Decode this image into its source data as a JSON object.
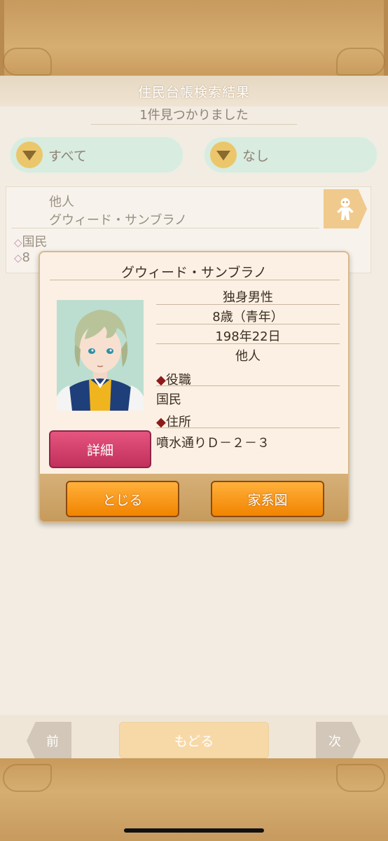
{
  "header": {
    "title": "住民台帳検索結果",
    "subtitle": "1件見つかりました"
  },
  "filters": [
    {
      "label": "すべて"
    },
    {
      "label": "なし"
    }
  ],
  "result_row": {
    "relation": "他人",
    "name": "グウィード・サンブラノ",
    "role_marker": "◇",
    "role": "国民",
    "address_marker": "◇",
    "address_partial": "8"
  },
  "modal": {
    "name": "グウィード・サンブラノ",
    "status": "独身男性",
    "age": "8歳（青年）",
    "birthday": "198年22日",
    "relation": "他人",
    "role_heading": "役職",
    "role_value": "国民",
    "address_heading": "住所",
    "address_value": "噴水通りＤ－２－３",
    "detail_button": "詳細",
    "close_button": "とじる",
    "family_tree_button": "家系図"
  },
  "bottom_nav": {
    "prev": "前",
    "back": "もどる",
    "next": "次"
  },
  "colors": {
    "wood": "#c9a370",
    "accent_orange": "#f28300",
    "detail_pink": "#c2305c",
    "filter_mint": "#d8ecdf"
  }
}
